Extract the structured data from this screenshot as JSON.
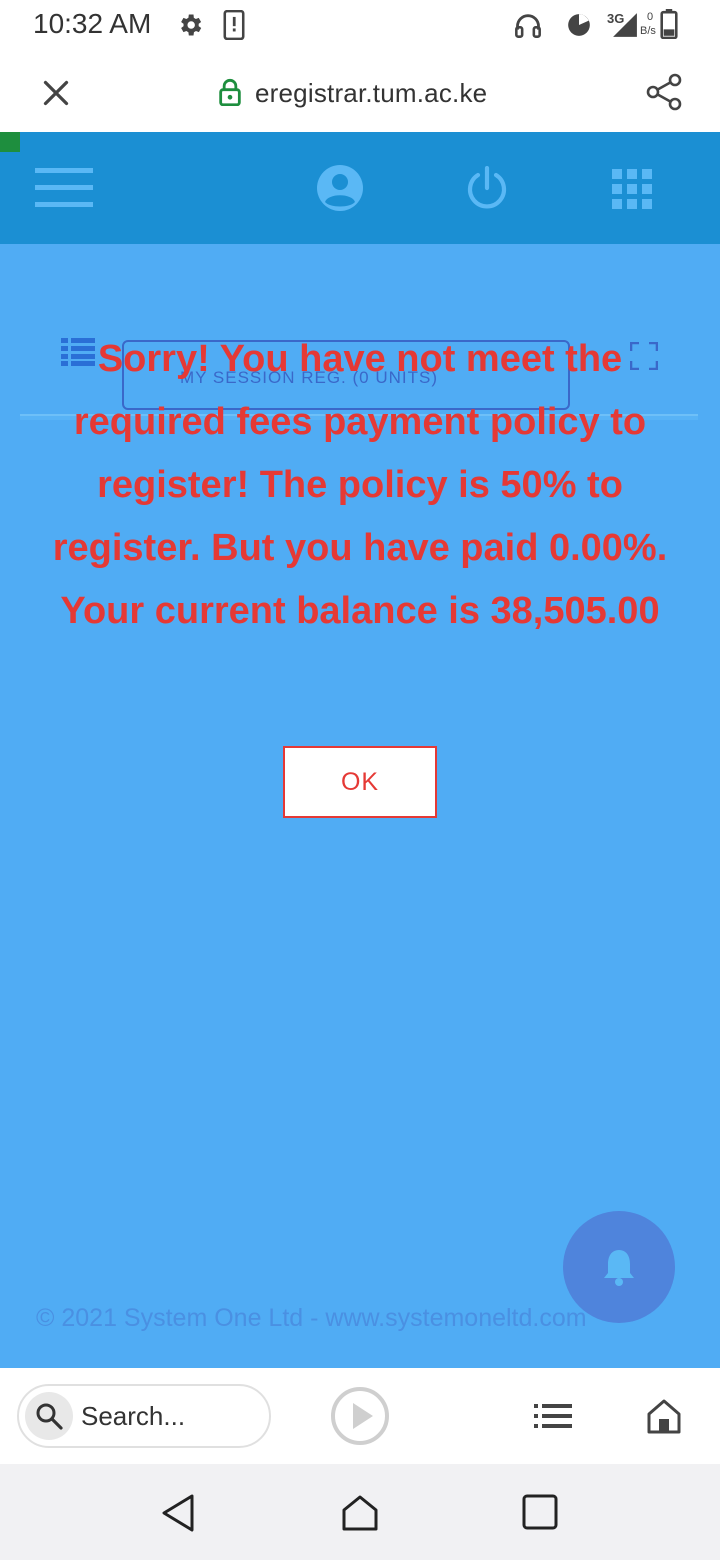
{
  "status_bar": {
    "time": "10:32 AM",
    "network": "3G",
    "speed_value": "0",
    "speed_unit": "B/s",
    "icons": [
      "gear-icon",
      "phone-alert-icon",
      "headphones-icon",
      "data-saver-icon",
      "signal-icon",
      "battery-icon"
    ]
  },
  "browser": {
    "url": "eregistrar.tum.ac.ke",
    "close_icon": "close-icon",
    "lock_icon": "lock-icon",
    "share_icon": "share-icon",
    "lock_color": "#1e8e3e"
  },
  "top_nav": {
    "icons": [
      "hamburger-menu-icon",
      "user-profile-icon",
      "power-icon",
      "apps-grid-icon"
    ],
    "background": "#1b8fd3"
  },
  "session_tab": {
    "label": "MY SESSION REG. (0 UNITS)"
  },
  "alert": {
    "message": "Sorry! You have not meet the required fees payment policy to register! The policy is 50% to register. But you have paid 0.00%. Your current balance is 38,505.00",
    "ok_label": "OK",
    "color": "#e53935"
  },
  "footer": {
    "text": "© 2021 System One Ltd - www.systemoneltd.com"
  },
  "bottom_toolbar": {
    "search_placeholder": "Search..."
  },
  "colors": {
    "page_background": "#50acf4",
    "accent": "#4f84dc"
  }
}
